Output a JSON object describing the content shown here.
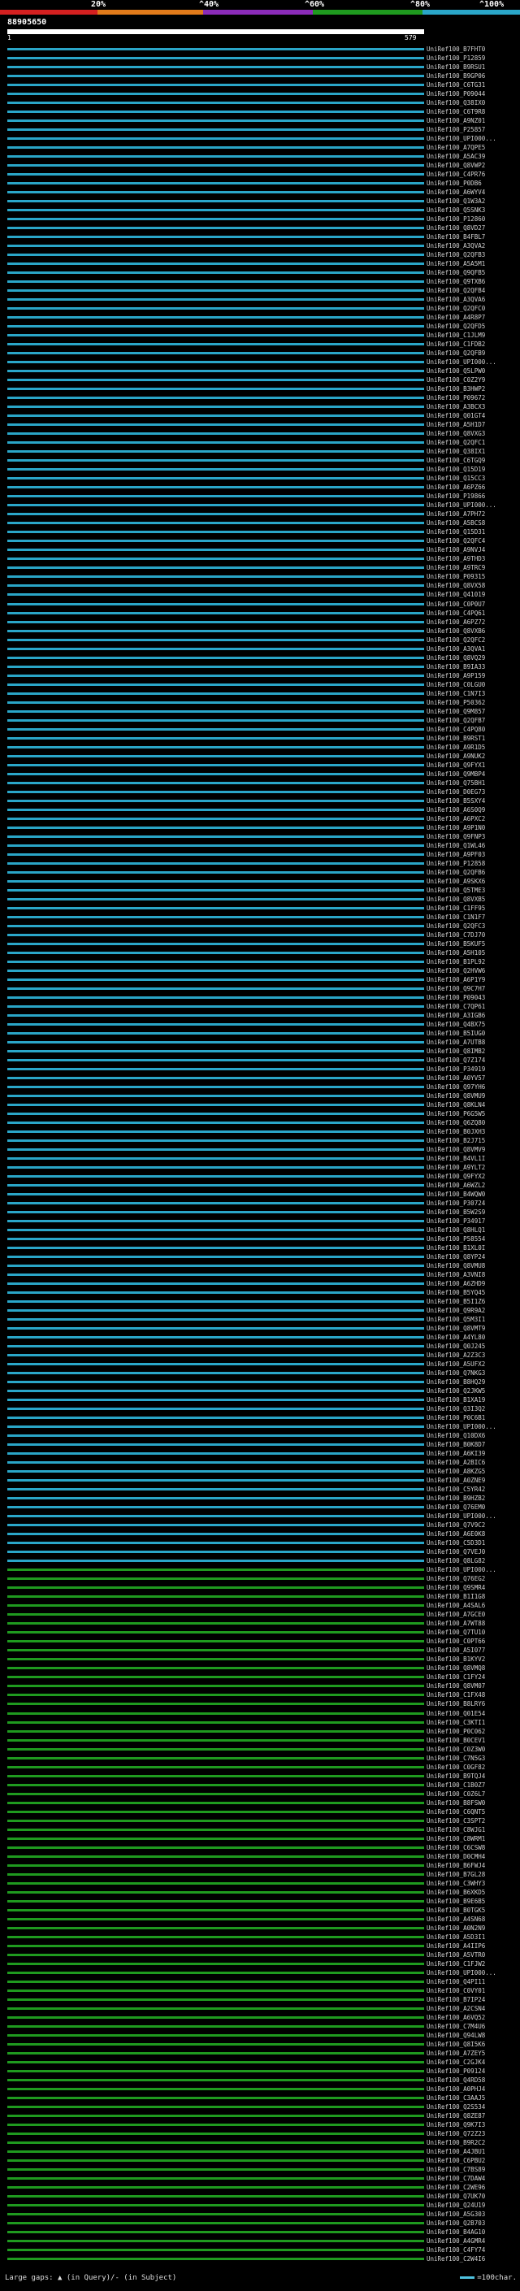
{
  "scale": {
    "labels": [
      "20%",
      "^40%",
      "^60%",
      "^80%",
      "^100%"
    ],
    "colors": [
      "#d42020",
      "#e07a1a",
      "#8a2bb8",
      "#1f9a1f",
      "#2aa6c8"
    ]
  },
  "query": {
    "name": "88905650",
    "start": "1",
    "end": "579"
  },
  "hits": [
    "UniRef100_B7FHT0",
    "UniRef100_P12859",
    "UniRef100_B9RSU1",
    "UniRef100_B9GP06",
    "UniRef100_C6TG31",
    "UniRef100_P09044",
    "UniRef100_Q38IX0",
    "UniRef100_C6T9R8",
    "UniRef100_A9NZ01",
    "UniRef100_P25857",
    "UniRef100_UPI000...",
    "UniRef100_A7QPE5",
    "UniRef100_A5AC39",
    "UniRef100_Q8VWP2",
    "UniRef100_C4PR76",
    "UniRef100_P0DB6",
    "UniRef100_A6WYV4",
    "UniRef100_Q1W3A2",
    "UniRef100_Q5SNK3",
    "UniRef100_P12860",
    "UniRef100_Q8VD27",
    "UniRef100_B4FBL7",
    "UniRef100_A3QVA2",
    "UniRef100_Q2QFB3",
    "UniRef100_A5A5M1",
    "UniRef100_Q9QFB5",
    "UniRef100_Q9TXB6",
    "UniRef100_Q2QFB4",
    "UniRef100_A3QVA6",
    "UniRef100_Q2QFC0",
    "UniRef100_A4R8P7",
    "UniRef100_Q2QFD5",
    "UniRef100_C1JLM9",
    "UniRef100_C1FDB2",
    "UniRef100_Q2QFB9",
    "UniRef100_UPI000...",
    "UniRef100_Q5LPW0",
    "UniRef100_C0Z2Y9",
    "UniRef100_B3HWP2",
    "UniRef100_P09672",
    "UniRef100_A3BCX3",
    "UniRef100_Q01GT4",
    "UniRef100_A5H1D7",
    "UniRef100_Q8VXG3",
    "UniRef100_Q2QFC1",
    "UniRef100_Q38IX1",
    "UniRef100_C6TGQ9",
    "UniRef100_Q15D19",
    "UniRef100_Q15CC3",
    "UniRef100_A6PZ66",
    "UniRef100_P19866",
    "UniRef100_UPI000...",
    "UniRef100_A7PH72",
    "UniRef100_A5BCS8",
    "UniRef100_Q15D31",
    "UniRef100_Q2QFC4",
    "UniRef100_A9NVJ4",
    "UniRef100_A9THD3",
    "UniRef100_A9TRC9",
    "UniRef100_P09315",
    "UniRef100_Q8VX58",
    "UniRef100_Q41019",
    "UniRef100_C0P0U7",
    "UniRef100_C4PQ61",
    "UniRef100_A6PZ72",
    "UniRef100_Q8VXB6",
    "UniRef100_Q2QFC2",
    "UniRef100_A3QVA1",
    "UniRef100_Q8VQ29",
    "UniRef100_B9IA33",
    "UniRef100_A9P159",
    "UniRef100_C0LGU0",
    "UniRef100_C1N7I3",
    "UniRef100_P50362",
    "UniRef100_Q9M857",
    "UniRef100_Q2QFB7",
    "UniRef100_C4PQ80",
    "UniRef100_B9RST1",
    "UniRef100_A9R1D5",
    "UniRef100_A9NUK2",
    "UniRef100_Q9FYX1",
    "UniRef100_Q9MBP4",
    "UniRef100_Q75BH1",
    "UniRef100_D0EG73",
    "UniRef100_B5SXY4",
    "UniRef100_A6S0Q9",
    "UniRef100_A6PXC2",
    "UniRef100_A9P1N0",
    "UniRef100_Q9FNP3",
    "UniRef100_Q1WL46",
    "UniRef100_A9PF03",
    "UniRef100_P12858",
    "UniRef100_Q2QFB6",
    "UniRef100_A9SKX6",
    "UniRef100_Q5TME3",
    "UniRef100_Q8VXB5",
    "UniRef100_C1FF95",
    "UniRef100_C1N1F7",
    "UniRef100_Q2QFC3",
    "UniRef100_C7DJ70",
    "UniRef100_B5KUF5",
    "UniRef100_A5H105",
    "UniRef100_B1PL92",
    "UniRef100_Q2HVW6",
    "UniRef100_A6P1Y9",
    "UniRef100_Q9C7H7",
    "UniRef100_P09043",
    "UniRef100_C7QP61",
    "UniRef100_A3IGB6",
    "UniRef100_Q4BX75",
    "UniRef100_B5IUG0",
    "UniRef100_A7UTB8",
    "UniRef100_Q8IMB2",
    "UniRef100_Q7Z174",
    "UniRef100_P34919",
    "UniRef100_A0YV57",
    "UniRef100_Q97YH6",
    "UniRef100_Q8VMU9",
    "UniRef100_Q8KLN4",
    "UniRef100_P6G5W5",
    "UniRef100_Q6ZQ80",
    "UniRef100_B0JXH3",
    "UniRef100_B2J715",
    "UniRef100_Q8VMV9",
    "UniRef100_B4VL1I",
    "UniRef100_A9YLT2",
    "UniRef100_Q9FYX2",
    "UniRef100_A6WZL2",
    "UniRef100_B4WQW0",
    "UniRef100_P30724",
    "UniRef100_B5W2S9",
    "UniRef100_P34917",
    "UniRef100_Q8HLQ1",
    "UniRef100_P58554",
    "UniRef100_B1XL0I",
    "UniRef100_Q8YP24",
    "UniRef100_Q8VMU8",
    "UniRef100_A3VNI8",
    "UniRef100_A6ZHD9",
    "UniRef100_B5YQ45",
    "UniRef100_B5I1Z6",
    "UniRef100_Q9R9A2",
    "UniRef100_Q5M3I1",
    "UniRef100_Q8VMT9",
    "UniRef100_A4YL80",
    "UniRef100_Q0J245",
    "UniRef100_A2Z3C3",
    "UniRef100_A5UFX2",
    "UniRef100_Q7NKG3",
    "UniRef100_B8HQ29",
    "UniRef100_Q2JKW5",
    "UniRef100_B1XA19",
    "UniRef100_Q3I3Q2",
    "UniRef100_P0C6B1",
    "UniRef100_UPI000...",
    "UniRef100_Q10DX6",
    "UniRef100_B0K8D7",
    "UniRef100_A6KI39",
    "UniRef100_A2BIC6",
    "UniRef100_A8KZG5",
    "UniRef100_A0ZNE9",
    "UniRef100_C5YR42",
    "UniRef100_B9HZB2",
    "UniRef100_Q76EM0",
    "UniRef100_UPI000...",
    "UniRef100_Q7V9C2",
    "UniRef100_A6E0K8",
    "UniRef100_C5D3D1",
    "UniRef100_Q7VEJ0",
    "UniRef100_Q8LG82",
    "UniRef100_UPI000...",
    "UniRef100_Q76EG2",
    "UniRef100_Q9SMR4",
    "UniRef100_B1I1G8",
    "UniRef100_A4SAL6",
    "UniRef100_A7GCE0",
    "UniRef100_A7WT88",
    "UniRef100_Q7TU10",
    "UniRef100_C0PT66",
    "UniRef100_A5I077",
    "UniRef100_B1KYV2",
    "UniRef100_Q8VMQ8",
    "UniRef100_C1FY24",
    "UniRef100_Q8VM07",
    "UniRef100_C1FX48",
    "UniRef100_B8LRY6",
    "UniRef100_Q01E54",
    "UniRef100_C3KTI1",
    "UniRef100_P0C062",
    "UniRef100_B0CEV1",
    "UniRef100_C0Z3W0",
    "UniRef100_C7N5G3",
    "UniRef100_C0GF82",
    "UniRef100_B9TQJ4",
    "UniRef100_C1B0Z7",
    "UniRef100_C0Z6L7",
    "UniRef100_B8FSW0",
    "UniRef100_C6QNT5",
    "UniRef100_C3SPT2",
    "UniRef100_C8WJG1",
    "UniRef100_C8WRM1",
    "UniRef100_C6CSW8",
    "UniRef100_D0CMH4",
    "UniRef100_B6FWJ4",
    "UniRef100_B7GL28",
    "UniRef100_C3WHY3",
    "UniRef100_B6XKD5",
    "UniRef100_B9E6B5",
    "UniRef100_B0TGK5",
    "UniRef100_A4SN68",
    "UniRef100_A0N2N9",
    "UniRef100_A5D3I1",
    "UniRef100_A4IIP6",
    "UniRef100_A5VTR0",
    "UniRef100_C1FJW2",
    "UniRef100_UPI000...",
    "UniRef100_Q4PI11",
    "UniRef100_C0VY01",
    "UniRef100_B7IP24",
    "UniRef100_A2CSN4",
    "UniRef100_A6VQ52",
    "UniRef100_C7M4U6",
    "UniRef100_Q94LW8",
    "UniRef100_Q8I5K6",
    "UniRef100_A7ZEY5",
    "UniRef100_C2GJK4",
    "UniRef100_P09124",
    "UniRef100_Q4RD58",
    "UniRef100_A0PHJ4",
    "UniRef100_C3AAJ5",
    "UniRef100_Q2S534",
    "UniRef100_Q8ZE87",
    "UniRef100_Q9K7I3",
    "UniRef100_Q72Z23",
    "UniRef100_B9R2C2",
    "UniRef100_A4JBU1",
    "UniRef100_C6PBU2",
    "UniRef100_C7BS89",
    "UniRef100_C7DAW4",
    "UniRef100_C2WE96",
    "UniRef100_Q7UK70",
    "UniRef100_Q24U19",
    "UniRef100_A5G303",
    "UniRef100_Q2B703",
    "UniRef100_B4AG10",
    "UniRef100_A4GMR4",
    "UniRef100_C4FY74",
    "UniRef100_C2W4I6"
  ],
  "legend": {
    "gaps": "Large gaps: ▲ (in Query)/- (in Subject)",
    "scale": "=100char."
  }
}
